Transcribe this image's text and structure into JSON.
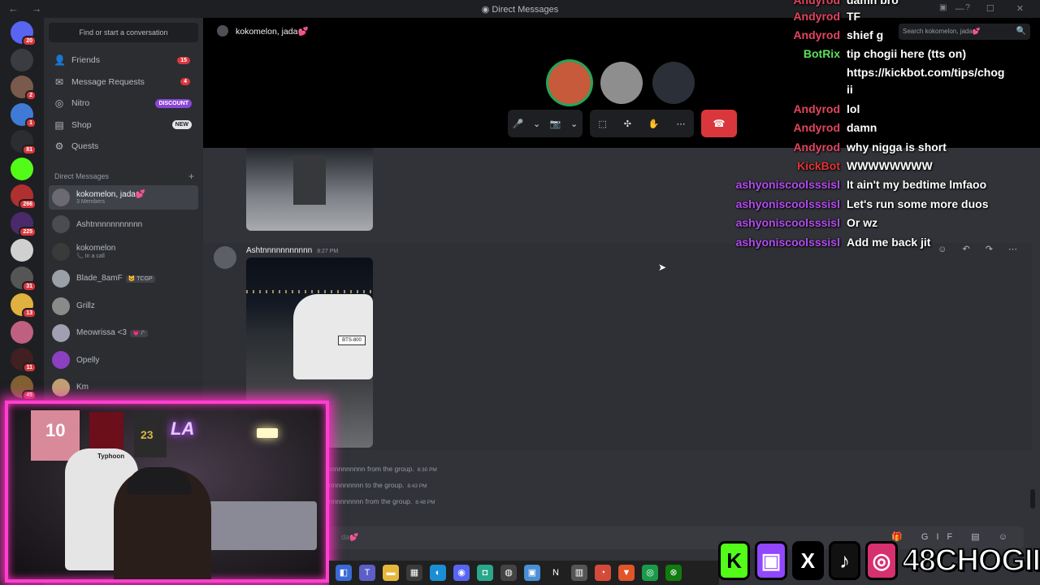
{
  "window": {
    "title": "Direct Messages",
    "nav_arrows": "← →",
    "controls": "— ☐ ✕"
  },
  "servers": [
    {
      "badge": "20",
      "color": "#5865f2"
    },
    {
      "badge": "",
      "color": "#3a3c41"
    },
    {
      "badge": "2",
      "color": "#7a5a4a"
    },
    {
      "badge": "1",
      "color": "#3f7bd6"
    },
    {
      "badge": "81",
      "color": "#2b2d31"
    },
    {
      "badge": "",
      "color": "#53fc18"
    },
    {
      "badge": "266",
      "color": "#b03030"
    },
    {
      "badge": "225",
      "color": "#4a2a6a"
    },
    {
      "badge": "",
      "color": "#d0d0d0"
    },
    {
      "badge": "31",
      "color": "#555"
    },
    {
      "badge": "13",
      "color": "#e0b040"
    },
    {
      "badge": "",
      "color": "#c06080"
    },
    {
      "badge": "11",
      "color": "#402020"
    },
    {
      "badge": "45",
      "color": "#806030"
    }
  ],
  "sidebar": {
    "find_placeholder": "Find or start a conversation",
    "nav": [
      {
        "label": "Friends",
        "icon": "friends-icon",
        "glyph": "👤",
        "count": "15"
      },
      {
        "label": "Message Requests",
        "icon": "mail-icon",
        "glyph": "✉",
        "count": "4"
      },
      {
        "label": "Nitro",
        "icon": "nitro-icon",
        "glyph": "◎",
        "pill": "DISCOUNT",
        "pill_color": "#8b46d8"
      },
      {
        "label": "Shop",
        "icon": "shop-icon",
        "glyph": "▤",
        "pill": "NEW",
        "pill_color": "#e3e5e8"
      },
      {
        "label": "Quests",
        "icon": "quests-icon",
        "glyph": "⚙"
      }
    ],
    "dm_header": "Direct Messages",
    "dm_add": "+",
    "dms": [
      {
        "name": "kokomelon, jada💕",
        "sub": "3 Members",
        "color": "#6a6a70",
        "selected": true
      },
      {
        "name": "Ashtnnnnnnnnnnn",
        "sub": "",
        "color": "#4a4c52"
      },
      {
        "name": "kokomelon",
        "sub": "📞 In a call",
        "color": "#3a3a3a"
      },
      {
        "name": "Blade_8amF",
        "sub": "",
        "tag": "🐱 TCGP",
        "color": "#9aa0a6"
      },
      {
        "name": "Grillz",
        "sub": "",
        "color": "#8a8a8a"
      },
      {
        "name": "Meowrissa <3",
        "sub": "",
        "tag": "💗 /ᐠ",
        "color": "#a0a0b0"
      },
      {
        "name": "Opelly",
        "sub": "",
        "color": "#8a40c0"
      },
      {
        "name": "Km",
        "sub": "",
        "color": "#c0a070"
      }
    ]
  },
  "call": {
    "title": "kokomelon, jada💕",
    "participants": [
      {
        "color": "#c65a3a",
        "ring": "#23a55a"
      },
      {
        "color": "#8e8e8e",
        "ring": ""
      },
      {
        "color": "#2a2f38",
        "ring": ""
      }
    ],
    "controls_a": [
      "🎤",
      "⌄",
      "📷",
      "⌄"
    ],
    "controls_b": [
      "⬚",
      "✣",
      "✋",
      "⋯"
    ],
    "hangup": "☎"
  },
  "search": {
    "placeholder": "Search kokomelon, jada💕",
    "icon": "🔍"
  },
  "top_icons": "▣ ?",
  "chat": {
    "message": {
      "author": "Ashtnnnnnnnnnnn",
      "time": "8:27 PM",
      "plate": "BTS-800"
    },
    "hover_actions": "☺ ↶ ↷ ⋯",
    "system": [
      {
        "text": "tnnnnnnnnnn from the group.",
        "time": "8:30 PM"
      },
      {
        "text": "nnnnnnnnnn to the group.",
        "time": "8:43 PM"
      },
      {
        "text": "nnnnnnnnnn from the group.",
        "time": "8:48 PM"
      }
    ],
    "input_placeholder": "da💕",
    "input_tools": "🎁 GIF ▤ ☺"
  },
  "stream_chat": [
    {
      "user": "Andyrod",
      "color": "#e2455e",
      "text": "damn bro"
    },
    {
      "user": "Andyrod",
      "color": "#e2455e",
      "text": "TF"
    },
    {
      "user": "Andyrod",
      "color": "#e2455e",
      "text": "shief g"
    },
    {
      "user": "BotRix",
      "color": "#5be15b",
      "text": "tip chogii here (tts on)"
    },
    {
      "user": "",
      "color": "#ffffff",
      "text": "https://kickbot.com/tips/chog"
    },
    {
      "user": "",
      "color": "#ffffff",
      "text": "ii"
    },
    {
      "user": "Andyrod",
      "color": "#e2455e",
      "text": "lol"
    },
    {
      "user": "Andyrod",
      "color": "#e2455e",
      "text": "damn"
    },
    {
      "user": "Andyrod",
      "color": "#e2455e",
      "text": "why nigga is short"
    },
    {
      "user": "KickBot",
      "color": "#e03535",
      "text": "WWWWWWWW"
    },
    {
      "user": "ashyoniscoolsssisl",
      "color": "#b44cf0",
      "text": "It ain't my bedtime lmfaoo"
    },
    {
      "user": "ashyoniscoolsssisl",
      "color": "#b44cf0",
      "text": "Let's run some more duos"
    },
    {
      "user": "ashyoniscoolsssisl",
      "color": "#b44cf0",
      "text": "Or wz"
    },
    {
      "user": "ashyoniscoolsssisl",
      "color": "#b44cf0",
      "text": "Add me back jit"
    }
  ],
  "webcam": {
    "jersey_number": "10",
    "jersey_number_2": "23",
    "neon_sign": "LA",
    "chair_brand": "Typhoon"
  },
  "taskbar": [
    {
      "icon": "app-icon",
      "glyph": "◧",
      "color": "#3a6ad4"
    },
    {
      "icon": "teams-icon",
      "glyph": "T",
      "color": "#5b5fc7"
    },
    {
      "icon": "folder-icon",
      "glyph": "▬",
      "color": "#e7b73c"
    },
    {
      "icon": "store-icon",
      "glyph": "▦",
      "color": "#3a3a3a"
    },
    {
      "icon": "edge-icon",
      "glyph": "◐",
      "color": "#1a8fd4"
    },
    {
      "icon": "discord-icon",
      "glyph": "◉",
      "color": "#5865f2"
    },
    {
      "icon": "app2-icon",
      "glyph": "◘",
      "color": "#2aa88a"
    },
    {
      "icon": "obs-icon",
      "glyph": "◍",
      "color": "#444"
    },
    {
      "icon": "app3-icon",
      "glyph": "▣",
      "color": "#4a8fd4"
    },
    {
      "icon": "netflix-icon",
      "glyph": "N",
      "color": "#202020"
    },
    {
      "icon": "app4-icon",
      "glyph": "▥",
      "color": "#555"
    },
    {
      "icon": "chrome-icon",
      "glyph": "◔",
      "color": "#d44a3a"
    },
    {
      "icon": "brave-icon",
      "glyph": "▼",
      "color": "#e0552a"
    },
    {
      "icon": "app5-icon",
      "glyph": "◎",
      "color": "#1a9a4a"
    },
    {
      "icon": "xbox-icon",
      "glyph": "⊗",
      "color": "#107c10"
    }
  ],
  "socials": {
    "handle": "48CHOGII",
    "items": [
      {
        "icon": "kick-icon",
        "glyph": "K",
        "bg": "#53fc18",
        "fg": "#000"
      },
      {
        "icon": "twitch-icon",
        "glyph": "▣",
        "bg": "#9146ff",
        "fg": "#fff"
      },
      {
        "icon": "x-icon",
        "glyph": "X",
        "bg": "#000",
        "fg": "#fff"
      },
      {
        "icon": "tiktok-icon",
        "glyph": "♪",
        "bg": "#111",
        "fg": "#fff"
      },
      {
        "icon": "instagram-icon",
        "glyph": "◎",
        "bg": "#d6306f",
        "fg": "#fff"
      }
    ]
  }
}
